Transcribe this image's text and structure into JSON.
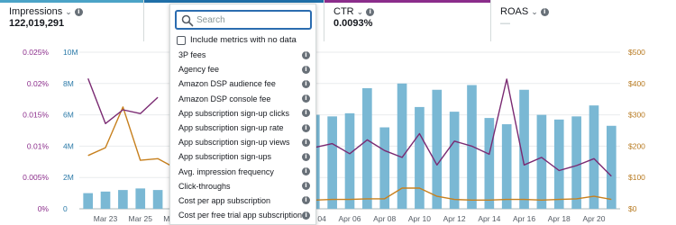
{
  "metrics": [
    {
      "label": "Impressions",
      "value": "122,019,291",
      "accent": "#4ba3c7"
    },
    {
      "label": "",
      "value": "",
      "accent": "#1f6fa8"
    },
    {
      "label": "CTR",
      "value": "0.0093%",
      "accent": "#8b2d8b"
    },
    {
      "label": "ROAS",
      "value": "—",
      "accent": "#ffffff"
    }
  ],
  "dropdown": {
    "search_placeholder": "Search",
    "include_label": "Include metrics with no data",
    "include_checked": false,
    "options": [
      "3P fees",
      "Agency fee",
      "Amazon DSP audience fee",
      "Amazon DSP console fee",
      "App subscription sign-up clicks",
      "App subscription sign-up rate",
      "App subscription sign-up views",
      "App subscription sign-ups",
      "Avg. impression frequency",
      "Click-throughs",
      "Cost per app subscription",
      "Cost per free trial app subscription"
    ]
  },
  "colors": {
    "bars": "#7ab8d4",
    "impressions_line": "#7a2a72",
    "spend_line": "#c7801e",
    "left_axis_text": "#8b2d8b",
    "mid_axis_text": "#2b7aa8",
    "right_axis_text": "#b7791f"
  },
  "chart_data": {
    "type": "bar",
    "dates": [
      "Mar 22",
      "Mar 23",
      "Mar 24",
      "Mar 25",
      "Mar 26",
      "Mar 27",
      "Mar 28",
      "Mar 29",
      "Mar 30",
      "Mar 31",
      "Apr 01",
      "Apr 02",
      "Apr 03",
      "Apr 04",
      "Apr 05",
      "Apr 06",
      "Apr 07",
      "Apr 08",
      "Apr 09",
      "Apr 10",
      "Apr 11",
      "Apr 12",
      "Apr 13",
      "Apr 14",
      "Apr 15",
      "Apr 16",
      "Apr 17",
      "Apr 18",
      "Apr 19",
      "Apr 20",
      "Apr 21"
    ],
    "x_tick_labels": [
      "Mar 23",
      "Mar 25",
      "Mar 27",
      "Apr 04",
      "Apr 06",
      "Apr 08",
      "Apr 10",
      "Apr 12",
      "Apr 14",
      "Apr 16",
      "Apr 18",
      "Apr 20"
    ],
    "y_left_ticks": [
      "0%",
      "0.005%",
      "0.01%",
      "0.015%",
      "0.02%",
      "0.025%"
    ],
    "y_mid_ticks": [
      "0",
      "2M",
      "4M",
      "6M",
      "8M",
      "10M"
    ],
    "y_right_ticks": [
      "$0",
      "$100",
      "$200",
      "$300",
      "$400",
      "$500"
    ],
    "ylim_impressions": [
      0,
      10000000
    ],
    "ylim_ctr": [
      0,
      0.025
    ],
    "ylim_spend": [
      0,
      500
    ],
    "series": [
      {
        "name": "Impressions",
        "kind": "bar",
        "values": [
          1000000.0,
          1100000.0,
          1200000.0,
          1300000.0,
          1200000.0,
          1100000.0,
          null,
          null,
          null,
          null,
          null,
          null,
          5300000.0,
          6000000.0,
          5900000.0,
          6100000.0,
          7700000.0,
          5200000.0,
          8000000.0,
          6500000.0,
          7600000.0,
          6200000.0,
          7900000.0,
          5800000.0,
          5400000.0,
          7600000.0,
          6000000.0,
          5700000.0,
          5900000.0,
          6600000.0,
          5300000.0
        ]
      },
      {
        "name": "CTR",
        "kind": "line",
        "values": [
          0.0208,
          0.0136,
          0.0158,
          0.0152,
          0.0178,
          null,
          null,
          null,
          null,
          null,
          null,
          null,
          0.0085,
          0.0098,
          0.0104,
          0.0088,
          0.011,
          0.0093,
          0.0082,
          0.012,
          0.007,
          0.0108,
          0.01,
          0.0087,
          0.0207,
          0.007,
          0.0082,
          0.0061,
          0.0069,
          0.008,
          0.0052
        ]
      },
      {
        "name": "Spend",
        "kind": "line",
        "values": [
          170,
          195,
          325,
          155,
          160,
          130,
          null,
          null,
          null,
          null,
          null,
          null,
          28,
          28,
          30,
          30,
          32,
          32,
          66,
          66,
          40,
          30,
          28,
          28,
          30,
          30,
          28,
          30,
          32,
          40,
          30
        ]
      }
    ]
  }
}
